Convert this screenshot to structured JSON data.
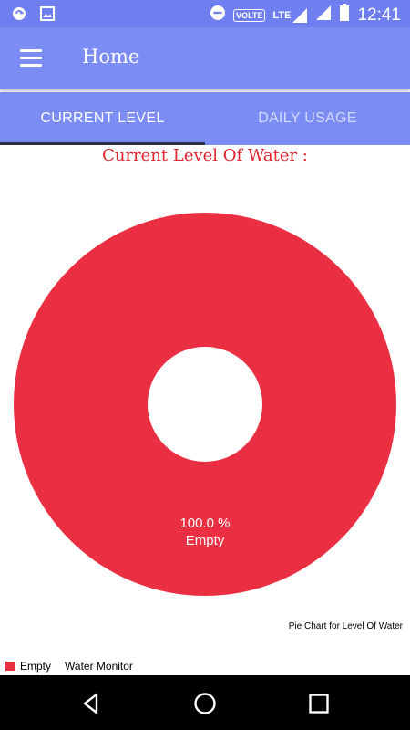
{
  "status_bar": {
    "time": "12:41",
    "network_badge": "VOLTE",
    "network_type": "LTE",
    "icons": [
      "sync-icon",
      "image-icon",
      "do-not-disturb-icon",
      "signal-icon",
      "battery-icon"
    ]
  },
  "app_bar": {
    "title": "Home"
  },
  "tabs": [
    {
      "label": "CURRENT LEVEL",
      "selected": true
    },
    {
      "label": "DAILY USAGE",
      "selected": false
    }
  ],
  "heading": "Current Level Of Water :",
  "chart_data": {
    "type": "pie",
    "style": "donut",
    "slices": [
      {
        "label": "Empty",
        "value": 100.0,
        "value_label": "100.0 %",
        "color": "#ea2f42"
      }
    ],
    "description": "Pie Chart for Level Of Water",
    "legend": {
      "entries": [
        "Empty"
      ],
      "title": "Water Monitor",
      "placement": "bottom-left"
    }
  },
  "colors": {
    "status_bar": "#6f7ff0",
    "app_bar": "#7b8cf4",
    "tab_indicator": "#2b2d4a",
    "heading": "#e0232f",
    "slice": "#ea2f42"
  },
  "nav_bar": {
    "buttons": [
      "back-icon",
      "home-icon",
      "recent-apps-icon"
    ]
  }
}
